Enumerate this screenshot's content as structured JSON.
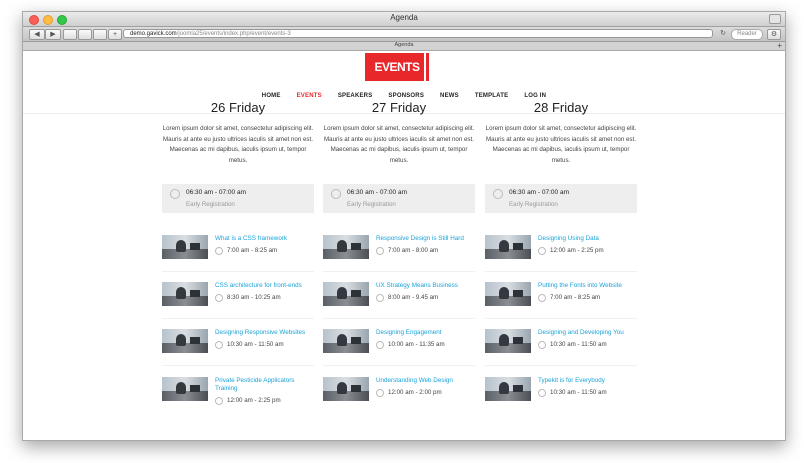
{
  "browser": {
    "window_title": "Agenda",
    "url_host": "demo.gavick.com",
    "url_path": "/joomla25/events/index.php/event/events-3",
    "reader_label": "Reader",
    "tab_title": "Agenda",
    "tab_add": "+",
    "back": "◀",
    "forward": "▶",
    "reload": "↻"
  },
  "site": {
    "logo_text": "EVENTS",
    "nav": [
      {
        "label": "HOME"
      },
      {
        "label": "EVENTS"
      },
      {
        "label": "SPEAKERS"
      },
      {
        "label": "SPONSORS"
      },
      {
        "label": "NEWS"
      },
      {
        "label": "TEMPLATE"
      },
      {
        "label": "LOG IN"
      }
    ],
    "accent": "#e8272b",
    "link_color": "#1ba2d8"
  },
  "days": [
    {
      "title": "26 Friday",
      "intro": "Lorem ipsum dolor sit amet, consectetur adipiscing elit. Mauris at ante eu justo ultrices iaculis sit amet non est. Maecenas ac mi dapibus, iaculis ipsum ut, tempor metus.",
      "registration": {
        "time": "06:30 am - 07:00 am",
        "title": "Early Registration"
      },
      "sessions": [
        {
          "title": "What is a CSS framework",
          "time": "7:00 am - 8:25 am"
        },
        {
          "title": "CSS architecture for front-ends",
          "time": "8:30 am - 10:25 am"
        },
        {
          "title": "Designing Responsive Websites",
          "time": "10:30 am - 11:50 am"
        },
        {
          "title": "Private Pesticide Applicators Training",
          "time": "12:00 am - 2:25 pm"
        }
      ]
    },
    {
      "title": "27 Friday",
      "intro": "Lorem ipsum dolor sit amet, consectetur adipiscing elit. Mauris at ante eu justo ultrices iaculis sit amet non est. Maecenas ac mi dapibus, iaculis ipsum ut, tempor metus.",
      "registration": {
        "time": "06:30 am - 07:00 am",
        "title": "Early Registration"
      },
      "sessions": [
        {
          "title": "Responsive Design is Still Hard",
          "time": "7:00 am - 8:00 am"
        },
        {
          "title": "UX Strategy Means Business",
          "time": "8:00 am - 9.45 am"
        },
        {
          "title": "Designing Engagement",
          "time": "10:00 am - 11:35 am"
        },
        {
          "title": "Understanding Web Design",
          "time": "12:00 am - 2:00 pm"
        }
      ]
    },
    {
      "title": "28 Friday",
      "intro": "Lorem ipsum dolor sit amet, consectetur adipiscing elit. Mauris at ante eu justo ultrices iaculis sit amet non est. Maecenas ac mi dapibus, iaculis ipsum ut, tempor metus.",
      "registration": {
        "time": "06:30 am - 07:00 am",
        "title": "Early Registration"
      },
      "sessions": [
        {
          "title": "Designing Using Data",
          "time": "12:00 am - 2:25 pm"
        },
        {
          "title": "Putting the Fonts into Website",
          "time": "7:00 am - 8:25 am"
        },
        {
          "title": "Designing and Developing You",
          "time": "10:30 am - 11:50 am"
        },
        {
          "title": "Typekit is for Everybody",
          "time": "10:30 am - 11:50 am"
        }
      ]
    }
  ]
}
